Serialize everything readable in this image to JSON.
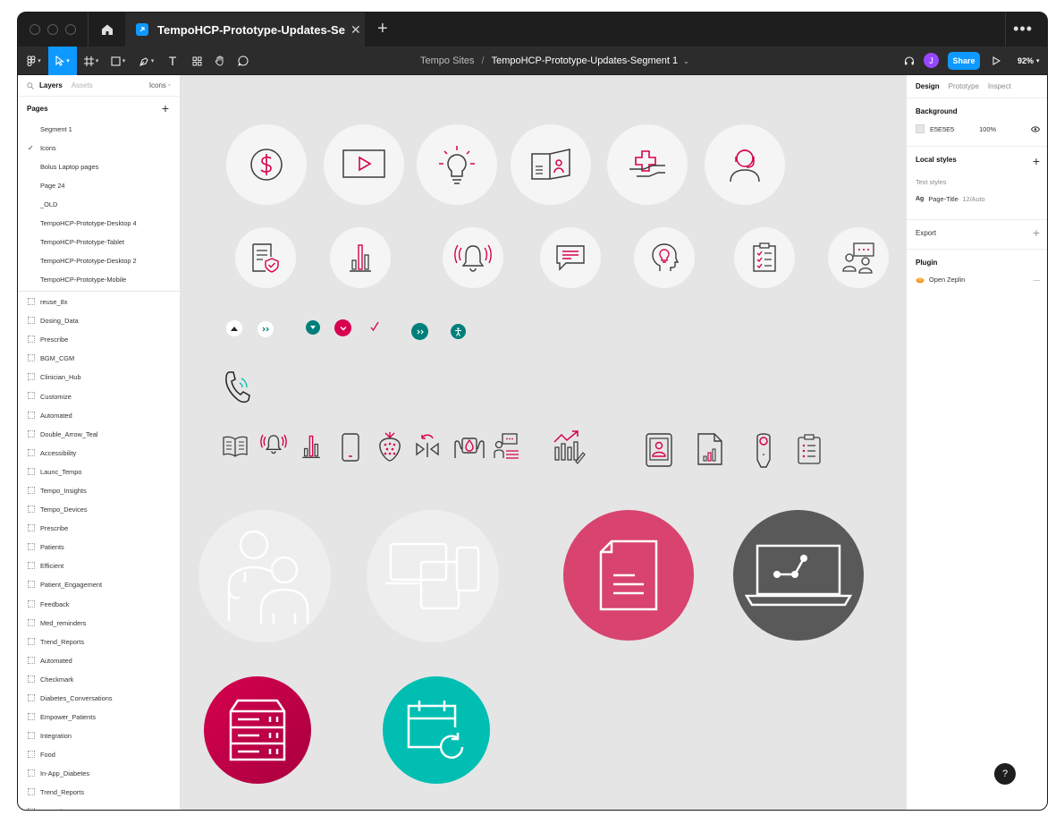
{
  "titlebar": {
    "tab_title": "TempoHCP-Prototype-Updates-Segme",
    "tab_close": "✕",
    "new_tab": "+",
    "more": "•••"
  },
  "toolbar": {
    "breadcrumb_team": "Tempo Sites",
    "breadcrumb_slash": "/",
    "breadcrumb_file": "TempoHCP-Prototype-Updates-Segment 1",
    "breadcrumb_chevron": "⌄",
    "avatar_initial": "J",
    "share_label": "Share",
    "zoom_level": "92%",
    "text_tool": "T"
  },
  "left_panel": {
    "tab_layers": "Layers",
    "tab_assets": "Assets",
    "current_page_ref": "Icons",
    "pages_title": "Pages",
    "pages_add": "+",
    "pages": [
      {
        "label": "Segment 1",
        "checked": ""
      },
      {
        "label": "Icons",
        "checked": "✓"
      },
      {
        "label": "Bolus Laptop pages",
        "checked": ""
      },
      {
        "label": "Page 24",
        "checked": ""
      },
      {
        "label": "_OLD",
        "checked": ""
      },
      {
        "label": "TempoHCP-Prototype-Desktop 4",
        "checked": ""
      },
      {
        "label": "TempoHCP-Prototype-Tablet",
        "checked": ""
      },
      {
        "label": "TempoHCP-Prototype-Desktop 2",
        "checked": ""
      },
      {
        "label": "TempoHCP-Prototype-Mobile",
        "checked": ""
      }
    ],
    "layers": [
      "reuse_8x",
      "Dosing_Data",
      "Prescribe",
      "BGM_CGM",
      "Clinician_Hub",
      "Customize",
      "Automated",
      "Double_Arrow_Teal",
      "Accessibility",
      "Launc_Tempo",
      "Tempo_Insights",
      "Tempo_Devices",
      "Prescribe",
      "Patients",
      "Efficient",
      "Patient_Engagement",
      "Feedback",
      "Med_reminders",
      "Trend_Reports",
      "Automated",
      "Checkmark",
      "Diabetes_Conversations",
      "Empower_Patients",
      "Integration",
      "Food",
      "In-App_Diabetes",
      "Trend_Reports",
      "Prescrib"
    ]
  },
  "right_panel": {
    "tab_design": "Design",
    "tab_prototype": "Prototype",
    "tab_inspect": "Inspect",
    "background_title": "Background",
    "background_hex": "E5E5E5",
    "background_opacity": "100%",
    "local_styles_title": "Local styles",
    "text_styles_label": "Text styles",
    "text_style_icon": "Ag",
    "text_style_name": "Page-Title",
    "text_style_meta": " · 12/Auto",
    "export_title": "Export",
    "plugin_title": "Plugin",
    "plugin_name": "Open Zeplin",
    "plus": "+",
    "minus": "—",
    "help": "?"
  },
  "colors": {
    "canvas_bg": "#E5E5E5",
    "accent_magenta": "#D6004F",
    "pink_circle": "#D8436F",
    "teal": "#007F7A",
    "teal_circle": "#00BFB2",
    "dark_circle": "#595959",
    "figma_blue": "#0D99FF",
    "avatar_purple": "#9747FF",
    "icon_stroke": "#3D3D3D"
  },
  "icons": [
    "dollar-icon",
    "video-play-icon",
    "lightbulb-icon",
    "brochure-icon",
    "medical-cross-icon",
    "support-agent-icon",
    "secure-document-icon",
    "bar-chart-icon",
    "notification-bell-icon",
    "chat-bubble-icon",
    "idea-head-icon",
    "checklist-clipboard-icon",
    "team-presentation-icon",
    "caret-up-icon",
    "double-chevron-icon",
    "caret-down-icon",
    "chevron-down-icon",
    "checkmark-icon",
    "accessibility-icon",
    "phone-call-icon",
    "open-book-icon",
    "smartphone-icon",
    "strawberry-icon",
    "sync-arrows-icon",
    "hands-drop-icon",
    "growth-chart-icon",
    "tablet-user-icon",
    "report-file-icon",
    "pen-device-icon",
    "clinician-patient-icon",
    "devices-icon",
    "document-icon",
    "laptop-trend-icon",
    "server-icon",
    "calendar-refresh-icon"
  ]
}
